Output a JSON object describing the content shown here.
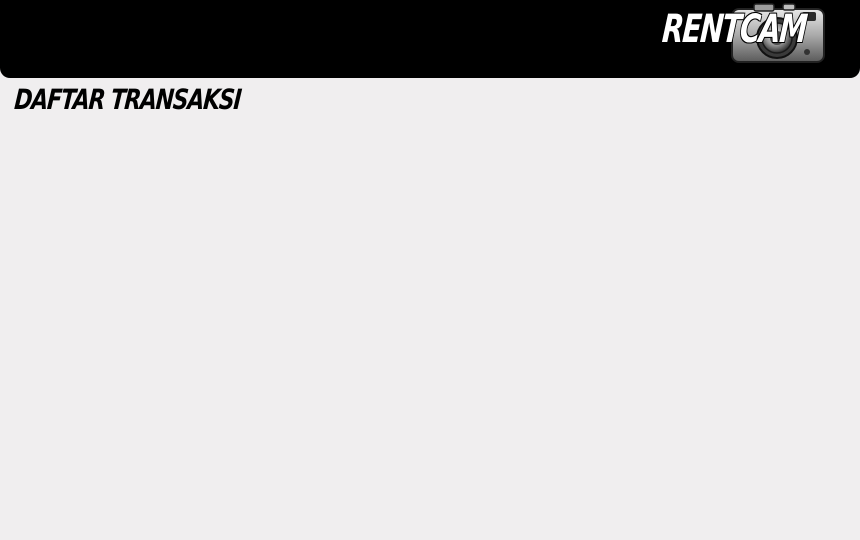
{
  "header": {
    "brand": "RENTCAM",
    "logo_icon": "camera-icon",
    "background_color": "#000000"
  },
  "main": {
    "title": "DAFTAR TRANSAKSI",
    "background_color": "#f0eeef"
  }
}
